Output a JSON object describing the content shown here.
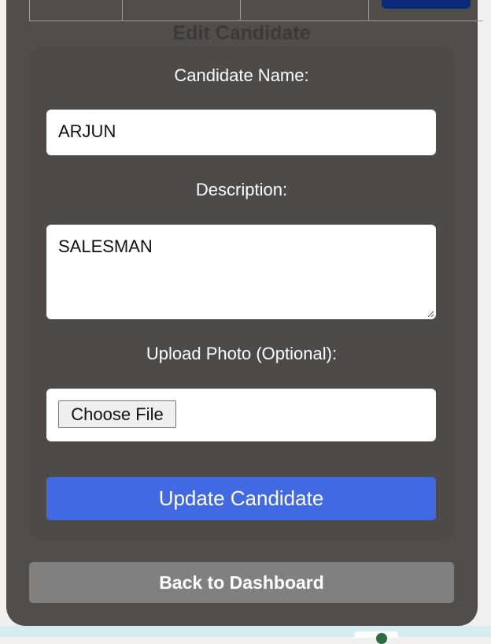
{
  "page": {
    "title": "Edit Candidate"
  },
  "form": {
    "name_label": "Candidate Name:",
    "name_value": "ARJUN",
    "description_label": "Description:",
    "description_value": "SALESMAN",
    "photo_label": "Upload Photo (Optional):",
    "choose_file_label": "Choose File",
    "submit_label": "Update Candidate"
  },
  "nav": {
    "back_label": "Back to Dashboard"
  },
  "colors": {
    "card": "#514d4b",
    "form_card": "#4e4a48",
    "primary_button": "#4169e1",
    "secondary_button": "#808080"
  }
}
